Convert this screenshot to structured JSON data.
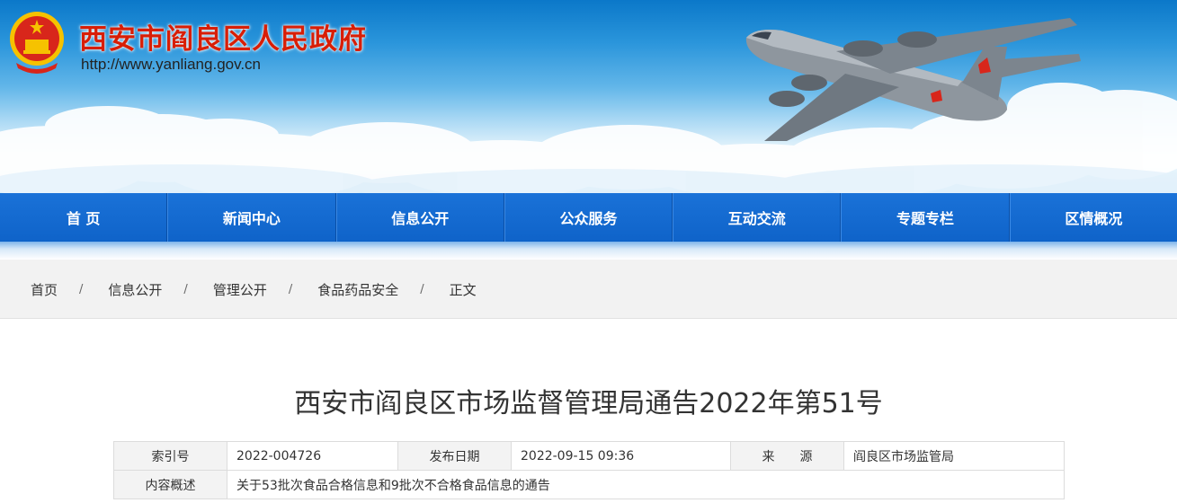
{
  "site": {
    "title": "西安市阎良区人民政府",
    "url": "http://www.yanliang.gov.cn"
  },
  "nav": {
    "items": [
      "首 页",
      "新闻中心",
      "信息公开",
      "公众服务",
      "互动交流",
      "专题专栏",
      "区情概况"
    ]
  },
  "breadcrumb": {
    "items": [
      "首页",
      "信息公开",
      "管理公开",
      "食品药品安全",
      "正文"
    ],
    "separator": "/"
  },
  "article": {
    "title": "西安市阎良区市场监督管理局通告2022年第51号"
  },
  "meta": {
    "index_label": "索引号",
    "index_value": "2022-004726",
    "date_label": "发布日期",
    "date_value": "2022-09-15 09:36",
    "source_label": "来　　源",
    "source_value": "阎良区市场监管局",
    "summary_label": "内容概述",
    "summary_value": "关于53批次食品合格信息和9批次不合格食品信息的通告"
  },
  "colors": {
    "nav": "#0f63c9",
    "title_red": "#d81e06"
  }
}
